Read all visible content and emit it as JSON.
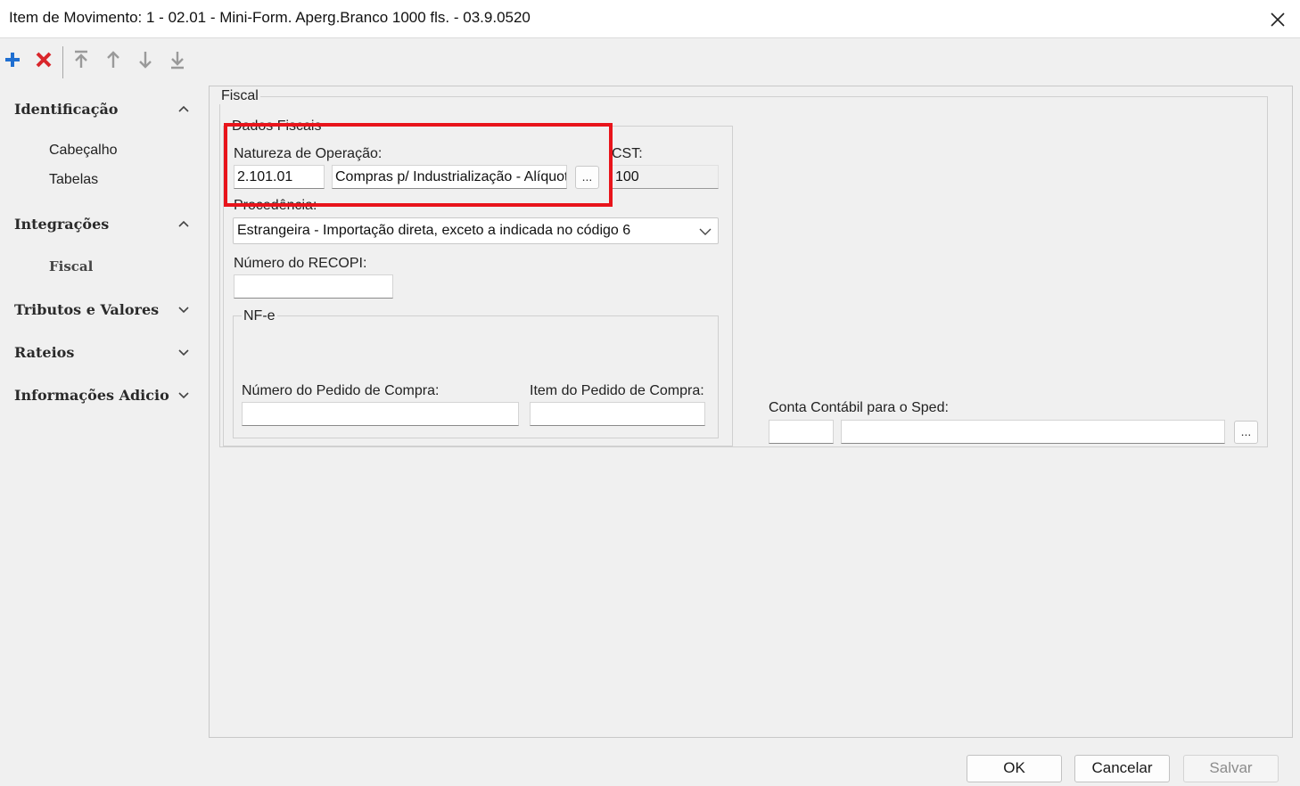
{
  "window": {
    "title": "Item de Movimento: 1 - 02.01 - Mini-Form. Aperg.Branco 1000 fls. - 03.9.0520",
    "close_icon": "close-icon"
  },
  "toolbar": {
    "icons": [
      "add-icon",
      "delete-icon",
      "move-first-icon",
      "move-up-icon",
      "move-down-icon",
      "move-last-icon"
    ],
    "colors": {
      "add": "#1f6fd1",
      "delete": "#d9262b",
      "disabled": "#9a9a9a"
    }
  },
  "nav": {
    "identificacao": "Identificação",
    "cabecalho": "Cabeçalho",
    "tabelas": "Tabelas",
    "integracoes": "Integrações",
    "fiscal": "Fiscal",
    "tributos": "Tributos e Valores",
    "rateios": "Rateios",
    "informacoes": "Informações Adicio"
  },
  "fiscal": {
    "group_title": "Fiscal",
    "dados_fiscais": {
      "title": "Dados Fiscais",
      "natureza_label": "Natureza de Operação:",
      "natureza_code": "2.101.01",
      "natureza_desc": "Compras p/ Industrialização - Alíquota",
      "lookup_label": "...",
      "cst_label": "CST:",
      "cst_value": "100",
      "procedencia_label": "Procedência:",
      "procedencia_value": "Estrangeira - Importação direta, exceto a indicada no código 6",
      "recopi_label": "Número do RECOPI:",
      "recopi_value": "",
      "nfe": {
        "title": "NF-e",
        "pedido_label": "Número do Pedido de Compra:",
        "pedido_value": "",
        "item_label": "Item do Pedido de Compra:",
        "item_value": ""
      }
    },
    "conta_contabil": {
      "label": "Conta Contábil para o Sped:",
      "code": "",
      "desc": "",
      "lookup_label": "..."
    }
  },
  "buttons": {
    "ok": "OK",
    "cancelar": "Cancelar",
    "salvar": "Salvar"
  },
  "highlight_color": "#e8141b"
}
